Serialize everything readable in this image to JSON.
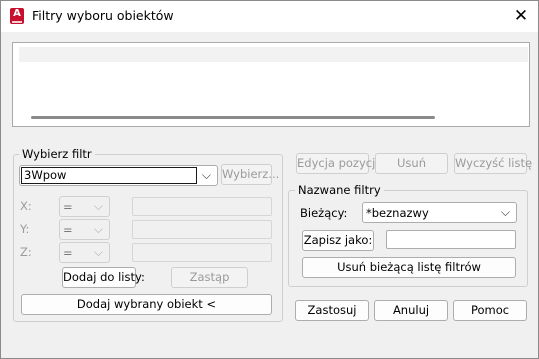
{
  "window": {
    "title": "Filtry wyboru obiektów",
    "app_icon_letter": "A",
    "close_glyph": "✕"
  },
  "select_filter": {
    "group_label": "Wybierz filtr",
    "object_type": "3Wpow",
    "select_button": "Wybierz...",
    "x_label": "X:",
    "y_label": "Y:",
    "z_label": "Z:",
    "x_operator": "=",
    "y_operator": "=",
    "z_operator": "=",
    "add_to_list_button": "Dodaj do listy:",
    "replace_button": "Zastąp",
    "add_selected_button": "Dodaj wybrany obiekt <"
  },
  "list_actions": {
    "edit_item_button": "Edycja pozycji",
    "delete_button": "Usuń",
    "clear_list_button": "Wyczyść listę"
  },
  "named_filters": {
    "group_label": "Nazwane filtry",
    "current_label": "Bieżący:",
    "current_value": "*beznazwy",
    "save_as_button": "Zapisz jako:",
    "save_as_value": "",
    "delete_current_button": "Usuń bieżącą listę filtrów"
  },
  "footer": {
    "apply_button": "Zastosuj",
    "cancel_button": "Anuluj",
    "help_button": "Pomoc"
  }
}
